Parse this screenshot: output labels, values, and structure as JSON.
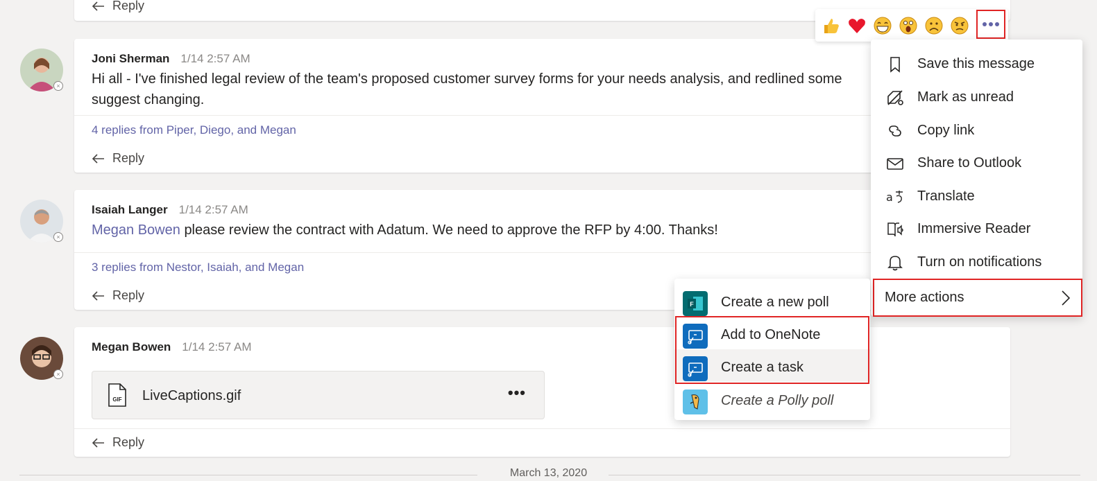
{
  "top_card": {
    "reply_label": "Reply"
  },
  "messages": [
    {
      "author": "Joni Sherman",
      "time": "1/14 2:57 AM",
      "body": "Hi all - I've finished legal review of the team's proposed customer survey forms for your needs analysis, and redlined some",
      "body_line2": "suggest changing.",
      "thread": "4 replies from Piper, Diego, and Megan",
      "reply_label": "Reply"
    },
    {
      "author": "Isaiah Langer",
      "time": "1/14 2:57 AM",
      "mention": "Megan Bowen",
      "body": "please review the contract with Adatum. We need to approve the RFP by 4:00. Thanks!",
      "thread": "3 replies from Nestor, Isaiah, and Megan",
      "reply_label": "Reply"
    },
    {
      "author": "Megan Bowen",
      "time": "1/14 2:57 AM",
      "file_name": "LiveCaptions.gif",
      "file_type": "GIF",
      "file_more": "•••",
      "reply_label": "Reply"
    }
  ],
  "date_separator": "March 13, 2020",
  "reactions": [
    "like-icon",
    "heart-icon",
    "laugh-icon",
    "surprised-icon",
    "sad-icon",
    "angry-icon"
  ],
  "context_menu": {
    "items": [
      {
        "label": "Save this message",
        "icon": "bookmark-icon"
      },
      {
        "label": "Mark as unread",
        "icon": "mark-unread-icon"
      },
      {
        "label": "Copy link",
        "icon": "link-icon"
      },
      {
        "label": "Share to Outlook",
        "icon": "mail-icon"
      },
      {
        "label": "Translate",
        "icon": "translate-icon"
      },
      {
        "label": "Immersive Reader",
        "icon": "immersive-reader-icon"
      },
      {
        "label": "Turn on notifications",
        "icon": "bell-icon"
      }
    ],
    "more_actions": "More actions"
  },
  "submenu": {
    "items": [
      {
        "label": "Create a new poll",
        "icon": "forms-icon"
      },
      {
        "label": "Add to OneNote",
        "icon": "onenote-icon"
      },
      {
        "label": "Create a task",
        "icon": "task-icon"
      },
      {
        "label": "Create a Polly poll",
        "icon": "polly-icon"
      }
    ]
  },
  "colors": {
    "accent": "#6264a7",
    "highlight": "#e02424",
    "background": "#f3f2f1"
  }
}
